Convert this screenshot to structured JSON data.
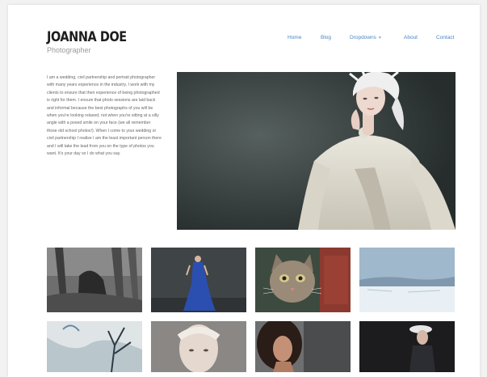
{
  "site": {
    "name": "JOANNA DOE",
    "tagline": "Photographer"
  },
  "nav": {
    "items": [
      {
        "label": "Home"
      },
      {
        "label": "Blog"
      },
      {
        "label": "Dropdowns"
      },
      {
        "label": "About"
      },
      {
        "label": "Contact"
      }
    ]
  },
  "bio": {
    "text": "I am a wedding, civil partnership and portrait photographer with many years experience in the industry. I work with my clients to ensure that their experience of being photographed is right for them. I ensure that photo sessions are laid back and informal because the best photographs of you will be when you're looking relaxed, not when you're sitting at a silly angle with a posed smile on your face (we all remember those old school photos!). When I come to your wedding or civil partnership I realise I am the least important person there and I will take the lead from you on the type of photos you want. It's your day so I do what you say."
  },
  "hero": {
    "alt": "woman in white lace dress with feathered headpiece",
    "icon": "photo-icon"
  },
  "gallery": [
    {
      "name": "forest-couple-photo"
    },
    {
      "name": "blue-dress-photo"
    },
    {
      "name": "kitten-photo"
    },
    {
      "name": "winter-landscape-photo"
    },
    {
      "name": "blue-tree-photo"
    },
    {
      "name": "wrapped-face-photo"
    },
    {
      "name": "curly-hair-photo"
    },
    {
      "name": "hat-portrait-photo"
    }
  ],
  "colors": {
    "link": "#4a86c5",
    "title": "#1d1d1d",
    "text": "#666666",
    "background": "#f2f2f2"
  }
}
